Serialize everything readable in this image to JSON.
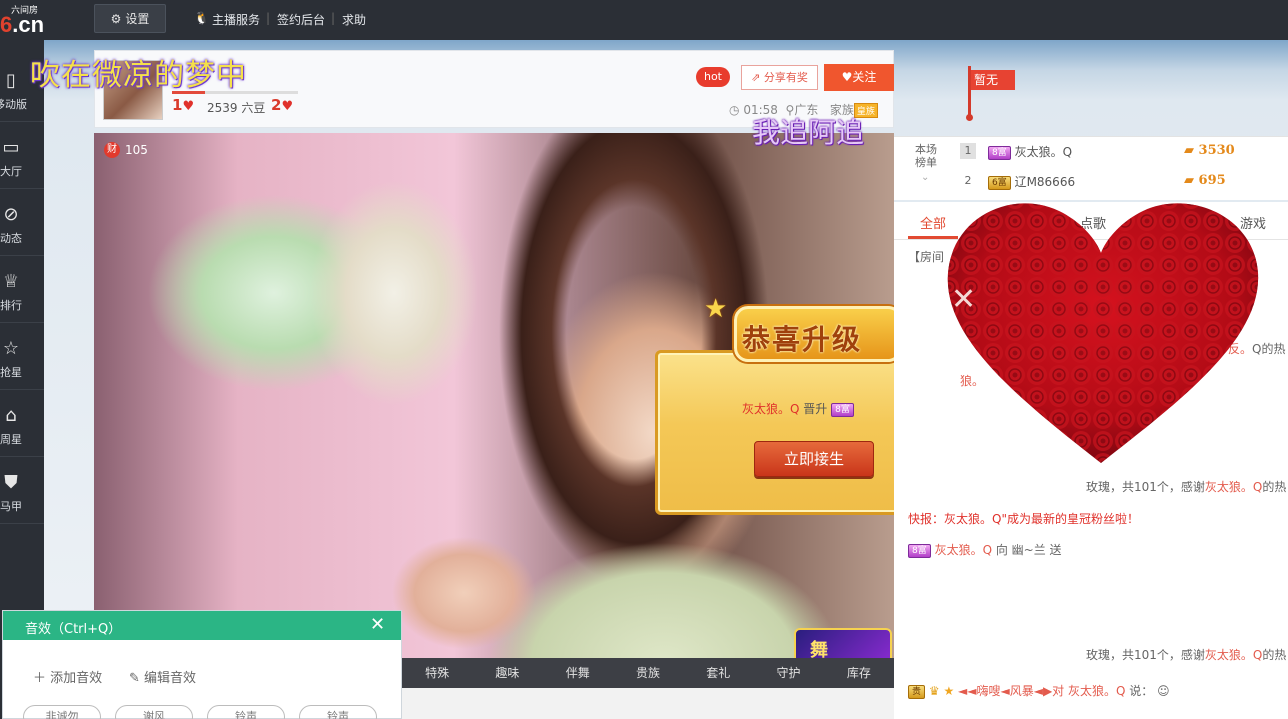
{
  "topbar": {
    "logo_small": "六间房",
    "logo_big_prefix": "6",
    "logo_big_suffix": ".cn",
    "settings_label": "设置",
    "links": [
      "主播服务",
      "签约后台",
      "求助"
    ]
  },
  "sidebar": {
    "items": [
      {
        "label": "移动版",
        "icon": "mobile-icon"
      },
      {
        "label": "大厅",
        "icon": "tv-icon"
      },
      {
        "label": "动态",
        "icon": "compass-icon"
      },
      {
        "label": "排行",
        "icon": "crown-icon"
      },
      {
        "label": "抢星",
        "icon": "star-icon"
      },
      {
        "label": "周星",
        "icon": "gift-icon"
      },
      {
        "label": "马甲",
        "icon": "shirt-icon"
      }
    ]
  },
  "anchor": {
    "name": "吹在微凉的梦中",
    "level_left": "1",
    "beans": "2539 六豆",
    "level_right": "2",
    "level_progress": 0.26,
    "hot_label": "hot",
    "share_label": "分享有奖",
    "follow_label": "关注",
    "time": "01:58",
    "location": "广东",
    "family_label": "家族",
    "family_tag": "皇族",
    "floating_chat": "我追阿追"
  },
  "video": {
    "wealth_icon": "财",
    "viewers": "105"
  },
  "levelup": {
    "title": "恭喜升级",
    "user": "灰太狼。Q",
    "action": "晋升",
    "badge": "8富",
    "button": "立即接生"
  },
  "video_toolbar": {
    "items": [
      "特殊",
      "趣味",
      "伴舞",
      "贵族",
      "套礼",
      "守护",
      "库存"
    ],
    "dance_badge": "舞"
  },
  "sfx": {
    "title": "音效（Ctrl+Q）",
    "add_label": "添加音效",
    "edit_label": "编辑音效",
    "chips": [
      "非诚勿",
      "谢风",
      "铃声",
      "铃声"
    ]
  },
  "right": {
    "flag_label": "暂无",
    "rank_label": "本场榜单",
    "rank": [
      {
        "num": "1",
        "badge": "8富",
        "name": "灰太狼。Q",
        "coins": "3530"
      },
      {
        "num": "2",
        "badge": "6富",
        "name": "辽M86666",
        "coins": "695"
      }
    ],
    "tabs": [
      "全部",
      "点歌",
      "游戏"
    ],
    "chat": [
      {
        "text": "【房间"
      },
      {
        "text": "玫瑰，共101个，感谢",
        "user": "灰太狼。Q",
        "tail": "的热"
      },
      {
        "prefix": "快报：",
        "text": "灰太狼。Q\"成为最新的皇冠粉丝啦！"
      },
      {
        "badge": "8富",
        "user": "灰太狼。Q",
        "text": "向 幽~兰 送"
      },
      {
        "text": "玫瑰，共101个，感谢",
        "user": "灰太狼。Q",
        "tail": "的热"
      },
      {
        "user_prefix": "◄◄嗨嗖◄风暴◄▶对",
        "user": "灰太狼。Q",
        "text": "说："
      }
    ]
  }
}
